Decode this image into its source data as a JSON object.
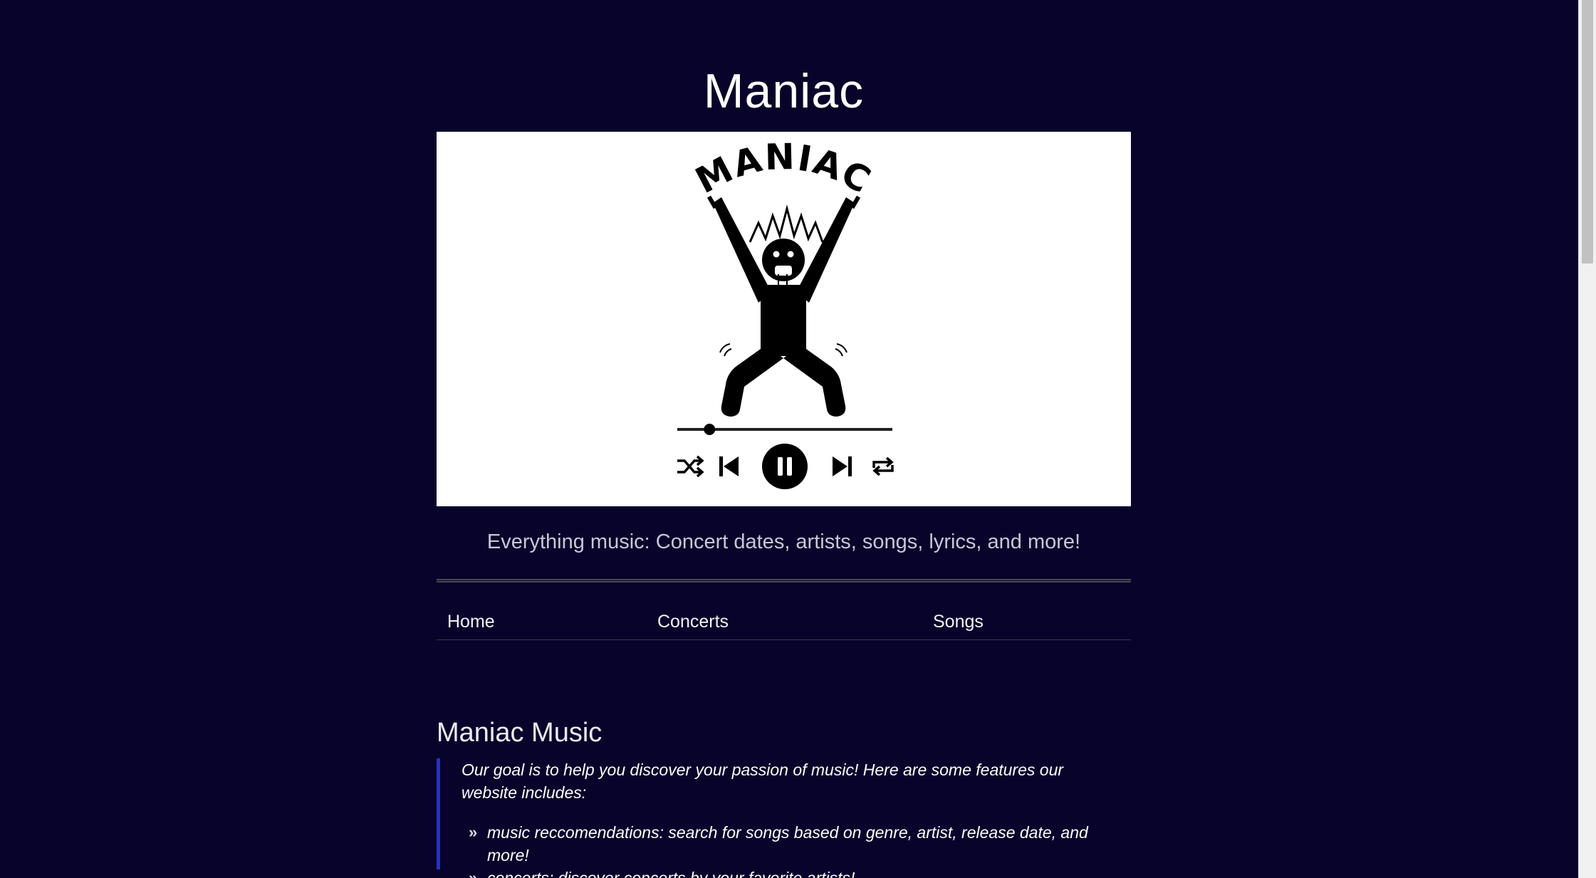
{
  "site": {
    "title": "Maniac",
    "logo_text": "MANIAC",
    "tagline": "Everything music: Concert dates, artists, songs, lyrics, and more!"
  },
  "nav": {
    "items": [
      {
        "label": "Home"
      },
      {
        "label": "Concerts"
      },
      {
        "label": "Songs"
      }
    ]
  },
  "main": {
    "heading": "Maniac Music",
    "intro": "Our goal is to help you discover your passion of music! Here are some features our website includes:",
    "features": [
      "music reccomendations: search for songs based on genre, artist, release date, and more!",
      "concerts: discover concerts by your favorite artists!"
    ],
    "bullet_glyph": "»"
  },
  "player": {
    "progress": 0.15,
    "state": "playing"
  },
  "icons": {
    "shuffle": "shuffle-icon",
    "previous": "skip-previous-icon",
    "pause": "pause-icon",
    "next": "skip-next-icon",
    "repeat": "repeat-icon"
  },
  "colors": {
    "background": "#07032a",
    "accent": "#2633c4",
    "text": "#ffffff",
    "muted_text": "#c9c6d6"
  }
}
